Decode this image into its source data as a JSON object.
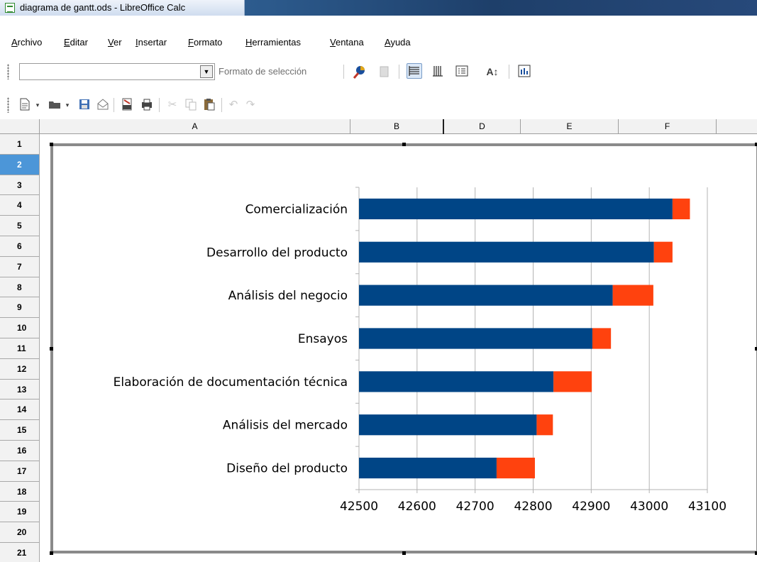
{
  "window": {
    "title": "diagrama de gantt.ods - LibreOffice Calc"
  },
  "menu": [
    "Archivo",
    "Editar",
    "Ver",
    "Insertar",
    "Formato",
    "Herramientas",
    "Ventana",
    "Ayuda"
  ],
  "format_toolbar": {
    "selection_combo_value": "",
    "format_selection_label": "Formato de selección"
  },
  "standard_toolbar": {
    "icons": [
      "new-document-icon",
      "open-folder-icon",
      "save-icon",
      "email-icon",
      "export-pdf-icon",
      "print-icon",
      "cut-icon",
      "copy-icon",
      "paste-icon",
      "undo-icon",
      "redo-icon"
    ]
  },
  "sheet": {
    "columns": [
      "A",
      "B",
      "D",
      "E",
      "F"
    ],
    "rows": [
      "1",
      "2",
      "3",
      "4",
      "5",
      "6",
      "7",
      "8",
      "9",
      "10",
      "11",
      "12",
      "13",
      "14",
      "15",
      "16",
      "17",
      "18",
      "19",
      "20",
      "21"
    ],
    "selected_row": "2"
  },
  "colors": {
    "series_start": "#004586",
    "series_duration": "#ff420e",
    "grid": "#b3b3b3",
    "row_highlight": "#4c96d8"
  },
  "chart_data": {
    "type": "bar",
    "orientation": "horizontal",
    "stacked": true,
    "categories": [
      "Comercialización",
      "Desarrollo del producto",
      "Análisis del negocio",
      "Ensayos",
      "Elaboración de documentación técnica",
      "Análisis del mercado",
      "Diseño del producto"
    ],
    "series": [
      {
        "values": [
          43040,
          43008,
          42937,
          42902,
          42835,
          42806,
          42737
        ]
      },
      {
        "values": [
          30,
          32,
          70,
          32,
          66,
          28,
          66
        ]
      }
    ],
    "x_ticks": [
      "42500",
      "42600",
      "42700",
      "42800",
      "42900",
      "43000",
      "43100"
    ],
    "xlim": [
      42500,
      43100
    ],
    "grid": "vertical",
    "legend": "none"
  }
}
